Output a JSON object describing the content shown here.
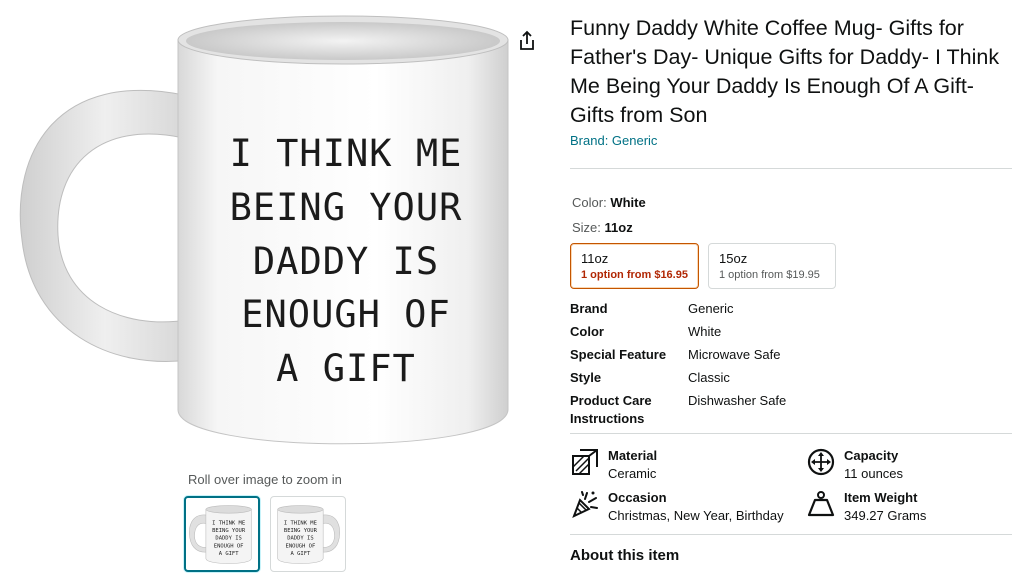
{
  "image": {
    "mug_text_lines": [
      "I THINK ME",
      "BEING YOUR",
      "DADDY IS",
      "ENOUGH OF",
      "A GIFT"
    ],
    "share_icon": "share-icon",
    "zoom_hint": "Roll over image to zoom in"
  },
  "product": {
    "title": "Funny Daddy White Coffee Mug- Gifts for Father's Day- Unique Gifts for Daddy- I Think Me Being Your Daddy Is Enough Of A Gift- Gifts from Son",
    "brand_link": "Brand: Generic"
  },
  "variations": {
    "color_label": "Color:",
    "color_value": "White",
    "size_label": "Size:",
    "size_value": "11oz",
    "sizes": [
      {
        "name": "11oz",
        "price": "1 option from $16.95",
        "selected": true
      },
      {
        "name": "15oz",
        "price": "1 option from $19.95",
        "selected": false
      }
    ]
  },
  "specs": [
    {
      "key": "Brand",
      "value": "Generic"
    },
    {
      "key": "Color",
      "value": "White"
    },
    {
      "key": "Special Feature",
      "value": "Microwave Safe"
    },
    {
      "key": "Style",
      "value": "Classic"
    },
    {
      "key": "Product Care Instructions",
      "value": "Dishwasher Safe"
    }
  ],
  "features": [
    {
      "icon": "material-icon",
      "title": "Material",
      "value": "Ceramic"
    },
    {
      "icon": "capacity-icon",
      "title": "Capacity",
      "value": "11 ounces"
    },
    {
      "icon": "occasion-icon",
      "title": "Occasion",
      "value": "Christmas, New Year, Birthday"
    },
    {
      "icon": "weight-icon",
      "title": "Item Weight",
      "value": "349.27 Grams"
    }
  ],
  "about_heading": "About this item",
  "colors": {
    "link": "#007185",
    "selected_border": "#c45500",
    "price_red": "#b12704",
    "thumb_selected": "#007185"
  }
}
